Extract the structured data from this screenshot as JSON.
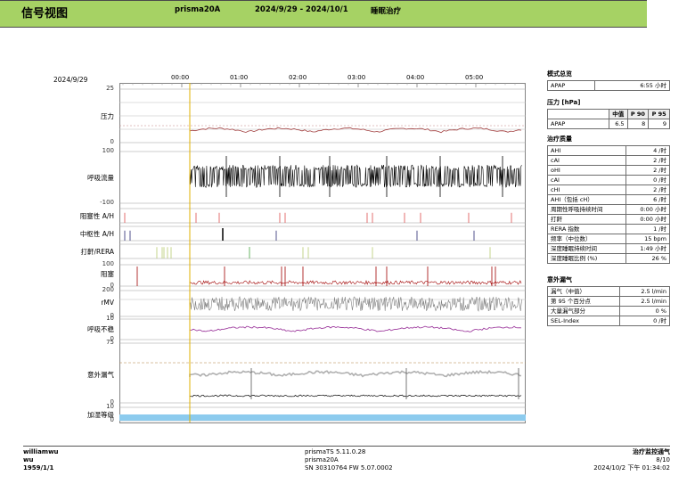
{
  "header": {
    "title": "信号视图",
    "device": "prisma20A",
    "date_range": "2024/9/29 - 2024/10/1",
    "therapy": "睡眠治疗",
    "color": "#a6d264"
  },
  "chart": {
    "date": "2024/9/29",
    "time_ticks": [
      "00:00",
      "01:00",
      "02:00",
      "03:00",
      "04:00",
      "05:00"
    ],
    "marker_color": "#e0b000",
    "rows": [
      {
        "label": "压力",
        "unit_max": "25",
        "unit_min": "0",
        "trace_color": "#a03c3c"
      },
      {
        "label": "呼吸流量",
        "unit_max": "100",
        "unit_min": "-100",
        "trace_color": "#000000"
      },
      {
        "label": "阻塞性 A/H",
        "event_color": "#e06060"
      },
      {
        "label": "中枢性 A/H",
        "event_color": "#404080"
      },
      {
        "label": "打鼾/RERA",
        "event_color": "#c0d080"
      },
      {
        "label": "阻塞",
        "unit_max": "100",
        "unit_min": "0",
        "trace_color": "#a00000"
      },
      {
        "label": "rMV",
        "unit_max": "200",
        "unit_min": "0",
        "trace_color": "#808080"
      },
      {
        "label": "呼吸不稳",
        "unit_max": "10",
        "unit_min": "0",
        "trace_color": "#a040a0"
      },
      {
        "label": "意外漏气",
        "unit_max": "75",
        "unit_min": "0",
        "trace_color": "#b0b0b0"
      },
      {
        "label": "加湿等级",
        "unit_max": "10",
        "unit_min": "0",
        "bar_color": "#8ccbee"
      }
    ]
  },
  "summary": {
    "mode_section": "模式总览",
    "mode_rows": [
      {
        "name": "APAP",
        "value": "6:55 小时"
      }
    ],
    "pressure_section": "压力 [hPa]",
    "pressure_headers": [
      "中值",
      "P 90",
      "P 95"
    ],
    "pressure_rows": [
      {
        "name": "APAP",
        "v1": "6.5",
        "v2": "8",
        "v3": "9"
      }
    ],
    "quality_section": "治疗质量",
    "quality_rows": [
      {
        "name": "AHI",
        "value": "4 /时"
      },
      {
        "name": "cAI",
        "value": "2 /时"
      },
      {
        "name": "oHI",
        "value": "2 /时"
      },
      {
        "name": "cAI",
        "value": "0 /时"
      },
      {
        "name": "cHI",
        "value": "2 /时"
      },
      {
        "name": "AHI（包括 cH）",
        "value": "6 /时"
      },
      {
        "name": "周期性呼吸持续时间",
        "value": "0:00 小时"
      },
      {
        "name": "打鼾",
        "value": "0:00 小时"
      },
      {
        "name": "RERA 指数",
        "value": "1 /时"
      },
      {
        "name": "频率（中位数）",
        "value": "15 bpm"
      },
      {
        "name": "深度睡眠持续时间",
        "value": "1:49 小时"
      },
      {
        "name": "深度睡眠比例 (%)",
        "value": "26 %"
      }
    ],
    "leak_section": "意外漏气",
    "leak_rows": [
      {
        "name": "漏气（中值）",
        "value": "2.5 l/min"
      },
      {
        "name": "第 95 个百分点",
        "value": "2.5 l/min"
      },
      {
        "name": "大量漏气部分",
        "value": "0 %"
      },
      {
        "name": "SEL-Index",
        "value": "0 /时"
      }
    ]
  },
  "footer": {
    "user": "williamwu",
    "user_short": "wu",
    "birth": "1959/1/1",
    "software": "prismaTS 5.11.0.28",
    "device": "prisma20A",
    "serial": "SN 30310764 FW 5.07.0002",
    "report": "治疗监控通气",
    "page": "8/10",
    "printed": "2024/10/2 下午 01:34:02"
  }
}
